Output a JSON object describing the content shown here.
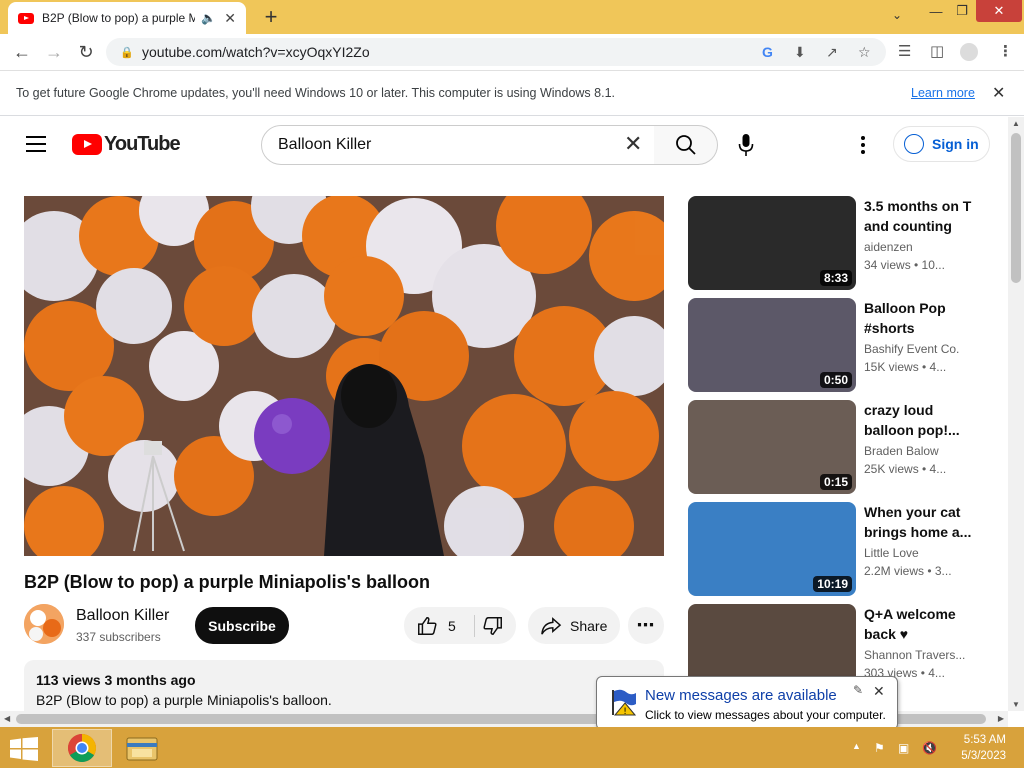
{
  "browser": {
    "tab_title": "B2P (Blow to pop) a purple M",
    "url": "youtube.com/watch?v=xcyOqxYI2Zo",
    "infobar": {
      "message": "To get future Google Chrome updates, you'll need Windows 10 or later. This computer is using Windows 8.1.",
      "link": "Learn more"
    }
  },
  "header": {
    "logo_text": "YouTube",
    "search_value": "Balloon Killer",
    "signin_label": "Sign in"
  },
  "video": {
    "title": "B2P (Blow to pop) a purple Miniapolis's balloon",
    "channel": "Balloon Killer",
    "subscribers": "337 subscribers",
    "subscribe_label": "Subscribe",
    "likes": "5",
    "share_label": "Share",
    "views_and_date": "113 views  3 months ago",
    "description": "B2P (Blow to pop) a purple Miniapolis's balloon."
  },
  "recommendations": [
    {
      "title": "3.5 months on T and counting",
      "channel": "aidenzen",
      "meta": "34 views • 10...",
      "duration": "8:33",
      "thumb_color": "#2a2a2a"
    },
    {
      "title": "Balloon Pop #shorts",
      "channel": "Bashify Event Co.",
      "meta": "15K views • 4...",
      "duration": "0:50",
      "thumb_color": "#5c5868"
    },
    {
      "title": "crazy loud balloon pop!...",
      "channel": "Braden Balow",
      "meta": "25K views • 4...",
      "duration": "0:15",
      "thumb_color": "#6b5d55"
    },
    {
      "title": "When your cat brings home a...",
      "channel": "Little Love",
      "meta": "2.2M views • 3...",
      "duration": "10:19",
      "thumb_color": "#3a7fc4"
    },
    {
      "title": "Q+A welcome back ♥",
      "channel": "Shannon Travers...",
      "meta": "303 views • 4...",
      "duration": "",
      "thumb_color": "#5a4a40"
    }
  ],
  "notification": {
    "title": "New messages are available",
    "body": "Click to view messages about your computer."
  },
  "taskbar": {
    "time": "5:53 AM",
    "date": "5/3/2023"
  }
}
